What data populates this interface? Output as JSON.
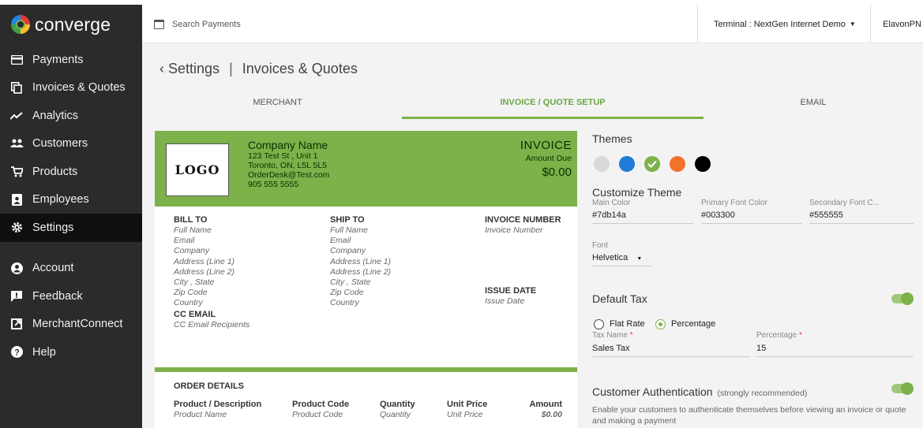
{
  "app": {
    "name": "converge"
  },
  "sidebar": {
    "items": [
      {
        "label": "Payments",
        "icon": "credit-card-icon"
      },
      {
        "label": "Invoices & Quotes",
        "icon": "copy-icon"
      },
      {
        "label": "Analytics",
        "icon": "trend-line-icon"
      },
      {
        "label": "Customers",
        "icon": "people-icon"
      },
      {
        "label": "Products",
        "icon": "cart-icon"
      },
      {
        "label": "Employees",
        "icon": "id-badge-icon"
      },
      {
        "label": "Settings",
        "icon": "gear-icon"
      },
      {
        "label": "Account",
        "icon": "user-circle-icon"
      },
      {
        "label": "Feedback",
        "icon": "comment-icon"
      },
      {
        "label": "MerchantConnect",
        "icon": "external-link-icon"
      },
      {
        "label": "Help",
        "icon": "help-circle-icon"
      }
    ],
    "active_index": 6
  },
  "header": {
    "search_placeholder": "Search Payments",
    "terminal": "Terminal : NextGen Internet Demo",
    "user": "ElavonPN"
  },
  "breadcrumb": {
    "back": "Settings",
    "current": "Invoices & Quotes"
  },
  "tabs": [
    {
      "label": "MERCHANT"
    },
    {
      "label": "INVOICE / QUOTE SETUP"
    },
    {
      "label": "EMAIL"
    }
  ],
  "invoice": {
    "logo": "LOGO",
    "company_name": "Company Name",
    "company_lines": [
      "123 Test St , Unit 1",
      "Toronto, ON, L5L 5L5",
      "OrderDesk@Test.com",
      "905 555 5555"
    ],
    "title": "INVOICE",
    "amount_due_label": "Amount Due",
    "amount_due": "$0.00",
    "bill_to": {
      "heading": "BILL TO",
      "lines": [
        "Full Name",
        "Email",
        "Company",
        "Address (Line 1)",
        "Address (Line 2)",
        "City , State",
        "Zip Code",
        "Country"
      ]
    },
    "cc_email": {
      "heading": "CC EMAIL",
      "value": "CC Email Recipients"
    },
    "ship_to": {
      "heading": "SHIP TO",
      "lines": [
        "Full Name",
        "Email",
        "Company",
        "Address (Line 1)",
        "Address (Line 2)",
        "City , State",
        "Zip Code",
        "Country"
      ]
    },
    "invoice_number": {
      "heading": "INVOICE NUMBER",
      "value": "Invoice Number"
    },
    "issue_date": {
      "heading": "ISSUE DATE",
      "value": "Issue Date"
    },
    "order_details": {
      "heading": "ORDER DETAILS",
      "columns": [
        {
          "header": "Product / Description",
          "value": "Product Name"
        },
        {
          "header": "Product Code",
          "value": "Product Code"
        },
        {
          "header": "Quantity",
          "value": "Quantity"
        },
        {
          "header": "Unit Price",
          "value": "Unit Price"
        },
        {
          "header": "Amount",
          "value": "$0.00"
        }
      ]
    }
  },
  "themes": {
    "heading": "Themes",
    "swatches": [
      "#d9d9d9",
      "#1e7bd6",
      "#7db14a",
      "#f0722b",
      "#000000"
    ],
    "selected_index": 2
  },
  "customize": {
    "heading": "Customize Theme",
    "main_color_label": "Main Color",
    "main_color": "#7db14a",
    "primary_font_label": "Primary Font Color",
    "primary_font": "#003300",
    "secondary_font_label": "Secondary Font C...",
    "secondary_font": "#555555",
    "font_label": "Font",
    "font": "Helvetica"
  },
  "tax": {
    "heading": "Default Tax",
    "enabled": true,
    "flat_rate": "Flat Rate",
    "percentage": "Percentage",
    "selected": "Percentage",
    "tax_name_label": "Tax Name",
    "tax_name": "Sales Tax",
    "percentage_label": "Percentage",
    "percentage_value": "15"
  },
  "auth": {
    "heading": "Customer Authentication",
    "note": "(strongly recommended)",
    "enabled": true,
    "description": "Enable your customers to authenticate themselves before viewing an invoice or quote and making a payment"
  },
  "colors": {
    "accent": "#7db14a",
    "sidebar": "#2b2b2b",
    "dark_green": "#003300"
  }
}
